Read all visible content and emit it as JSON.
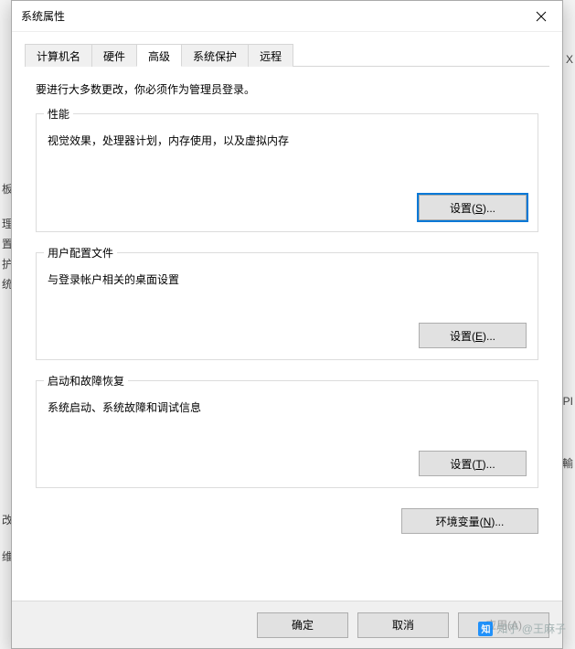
{
  "window": {
    "title": "系统属性"
  },
  "tabs": {
    "computer_name": "计算机名",
    "hardware": "硬件",
    "advanced": "高级",
    "system_protection": "系统保护",
    "remote": "远程"
  },
  "intro": "要进行大多数更改，你必须作为管理员登录。",
  "groups": {
    "performance": {
      "title": "性能",
      "desc": "视觉效果，处理器计划，内存使用，以及虚拟内存",
      "button": "设置(S)...",
      "button_key": "S"
    },
    "user_profiles": {
      "title": "用户配置文件",
      "desc": "与登录帐户相关的桌面设置",
      "button": "设置(E)...",
      "button_key": "E"
    },
    "startup": {
      "title": "启动和故障恢复",
      "desc": "系统启动、系统故障和调试信息",
      "button": "设置(T)...",
      "button_key": "T"
    }
  },
  "env_button": "环境变量(N)...",
  "env_button_key": "N",
  "footer": {
    "ok": "确定",
    "cancel": "取消",
    "apply": "应用(A)"
  },
  "watermark": "知乎 @王麻子",
  "bg": {
    "l1": "板",
    "l2": "理",
    "l3": "置",
    "l4": "护",
    "l5": "统",
    "l6": "改",
    "l7": "维",
    "r1": "X",
    "r2": "PI",
    "r3": "輸"
  }
}
